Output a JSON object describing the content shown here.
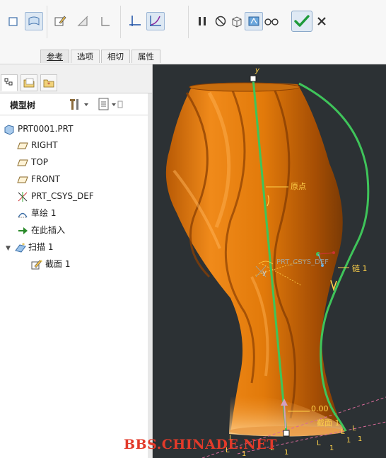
{
  "ribbon": {
    "tabs": [
      "参考",
      "选项",
      "相切",
      "属性"
    ],
    "selected_tab": "参考"
  },
  "model_tree": {
    "title": "模型树",
    "items": [
      {
        "label": "PRT0001.PRT",
        "icon": "part-icon"
      },
      {
        "label": "RIGHT",
        "icon": "datum-plane-icon"
      },
      {
        "label": "TOP",
        "icon": "datum-plane-icon"
      },
      {
        "label": "FRONT",
        "icon": "datum-plane-icon"
      },
      {
        "label": "PRT_CSYS_DEF",
        "icon": "csys-icon"
      },
      {
        "label": "草绘 1",
        "icon": "sketch-icon"
      },
      {
        "label": "在此插入",
        "icon": "insert-arrow-icon"
      },
      {
        "label": "扫描 1",
        "icon": "sweep-icon"
      },
      {
        "label": "截面 1",
        "icon": "section-icon"
      }
    ]
  },
  "viewport": {
    "labels": {
      "origin": "原点",
      "chain": "链 1",
      "csys": "PRT_CSYS_DEF",
      "y_axis": "y",
      "value": "0.00",
      "section": "截面 1",
      "l_marker": "L",
      "one_marker": "1",
      "watermark": "BBS.CHINADE.NET"
    },
    "colors": {
      "background": "#2c3134",
      "body": "#e07a0c",
      "trajectory": "#3fc45a",
      "watermark": "#e23a2a"
    }
  }
}
